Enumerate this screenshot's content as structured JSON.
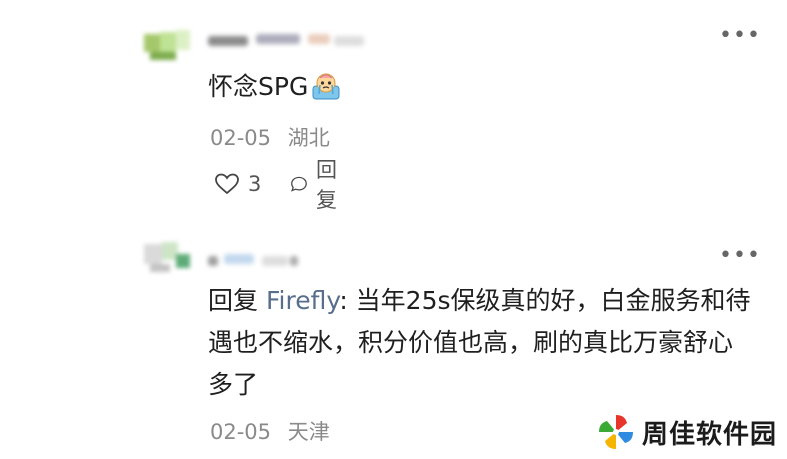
{
  "comments": [
    {
      "text": "怀念SPG",
      "emoji": "crying-face-emoji",
      "date": "02-05",
      "location": "湖北",
      "like_count": "3",
      "reply_label": "回复",
      "more_label": "•••"
    },
    {
      "reply_prefix": "回复",
      "reply_target": "Firefly",
      "text": ": 当年25s保级真的好，白金服务和待遇也不缩水，积分价值也高，刷的真比万豪舒心多了",
      "date": "02-05",
      "location": "天津",
      "more_label": "•••"
    }
  ],
  "watermark": {
    "text": "周佳软件园",
    "colors": [
      "#e8352b",
      "#2f8be0",
      "#f4b400",
      "#3aaa35"
    ]
  }
}
